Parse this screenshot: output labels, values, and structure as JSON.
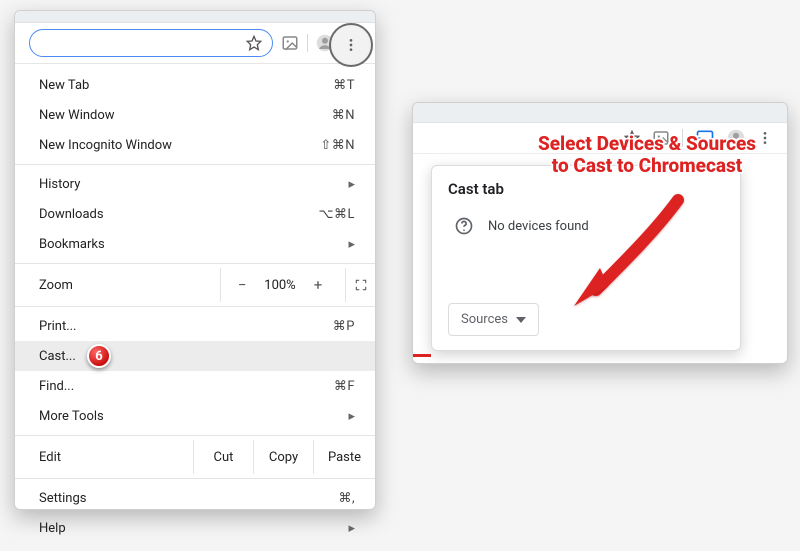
{
  "toolbar": {
    "image_icon": "image-icon",
    "profile_icon": "profile-icon",
    "more_icon": "more-vert-icon"
  },
  "menu": {
    "new_tab": {
      "label": "New Tab",
      "shortcut": "⌘T"
    },
    "new_window": {
      "label": "New Window",
      "shortcut": "⌘N"
    },
    "new_incognito": {
      "label": "New Incognito Window",
      "shortcut": "⇧⌘N"
    },
    "history": {
      "label": "History"
    },
    "downloads": {
      "label": "Downloads",
      "shortcut": "⌥⌘L"
    },
    "bookmarks": {
      "label": "Bookmarks"
    },
    "zoom": {
      "label": "Zoom",
      "minus": "−",
      "value": "100%",
      "plus": "+"
    },
    "print": {
      "label": "Print...",
      "shortcut": "⌘P"
    },
    "cast": {
      "label": "Cast..."
    },
    "find": {
      "label": "Find...",
      "shortcut": "⌘F"
    },
    "more_tools": {
      "label": "More Tools"
    },
    "edit": {
      "label": "Edit",
      "cut": "Cut",
      "copy": "Copy",
      "paste": "Paste"
    },
    "settings": {
      "label": "Settings",
      "shortcut": "⌘,"
    },
    "help": {
      "label": "Help"
    }
  },
  "badge6": "6",
  "cast": {
    "title": "Cast tab",
    "status": "No devices found",
    "sources_label": "Sources"
  },
  "annotation": {
    "line1": "Select Devices & Sources",
    "line2": "to Cast to Chromecast"
  }
}
